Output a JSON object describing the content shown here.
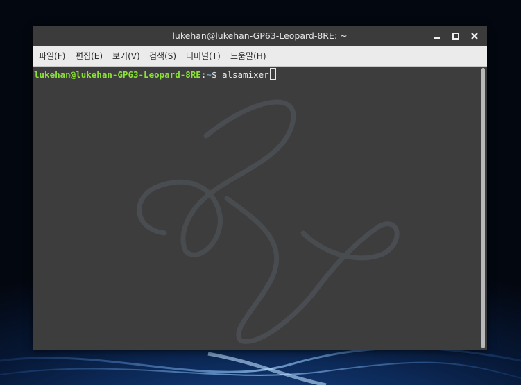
{
  "window": {
    "title": "lukehan@lukehan-GP63-Leopard-8RE: ~",
    "controls": {
      "minimize_icon": "minimize-icon",
      "maximize_icon": "maximize-icon",
      "close_icon": "close-icon"
    }
  },
  "menubar": {
    "items": [
      {
        "label": "파일(F)"
      },
      {
        "label": "편집(E)"
      },
      {
        "label": "보기(V)"
      },
      {
        "label": "검색(S)"
      },
      {
        "label": "터미널(T)"
      },
      {
        "label": "도움말(H)"
      }
    ]
  },
  "terminal": {
    "prompt_user": "lukehan@lukehan-GP63-Leopard-8RE",
    "prompt_sep": ":",
    "prompt_path": "~",
    "prompt_symbol": "$ ",
    "command": "alsamixer"
  },
  "colors": {
    "prompt_user": "#8ae234",
    "prompt_path": "#729fcf",
    "terminal_bg": "#3d3d3d",
    "menubar_bg": "#ebebeb",
    "titlebar_bg": "#3b3b3b"
  }
}
